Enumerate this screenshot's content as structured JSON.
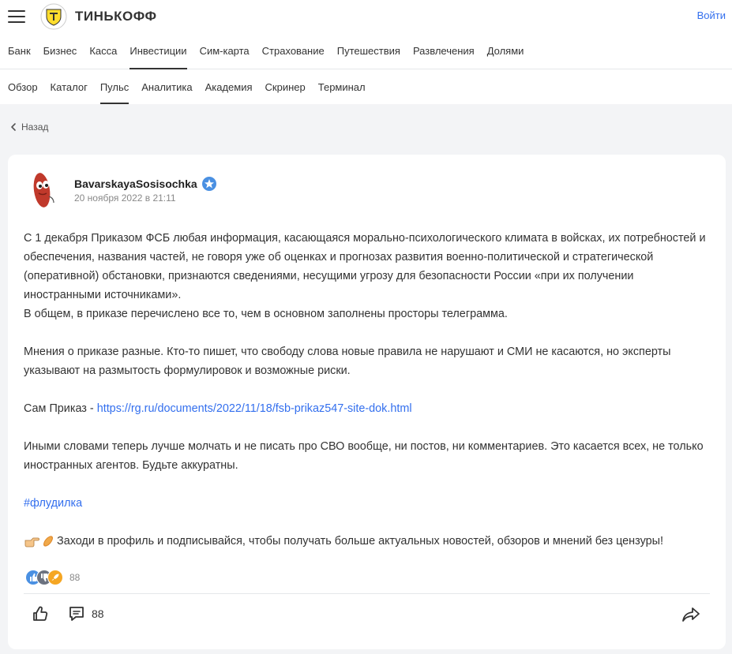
{
  "header": {
    "brand": "ТИНЬКОФФ",
    "login_label": "Войти"
  },
  "main_nav": {
    "items": [
      "Банк",
      "Бизнес",
      "Касса",
      "Инвестиции",
      "Сим-карта",
      "Страхование",
      "Путешествия",
      "Развлечения",
      "Долями"
    ],
    "active": "Инвестиции"
  },
  "sub_nav": {
    "items": [
      "Обзор",
      "Каталог",
      "Пульс",
      "Аналитика",
      "Академия",
      "Скринер",
      "Терминал"
    ],
    "active": "Пульс"
  },
  "back_label": "Назад",
  "post": {
    "author": "BavarskayaSosisochka",
    "date": "20 ноября 2022 в 21:11",
    "paragraph1": "С 1 декабря Приказом ФСБ любая информация, касающаяся морально-психологического климата в войсках, их потребностей и обеспечения, названия частей, не говоря уже об оценках и прогнозах развития военно-политической и стратегической (оперативной) обстановки, признаются сведениями, несущими угрозу для безопасности России «при их получении иностранными источниками».",
    "paragraph2": "В общем, в приказе перечислено все то, чем в основном заполнены просторы телеграмма.",
    "paragraph3": "Мнения о приказе разные. Кто-то пишет, что свободу слова новые правила не нарушают и СМИ не касаются, но эксперты указывают на размытость формулировок и возможные риски.",
    "order_label": "Сам Приказ - ",
    "order_link": "https://rg.ru/documents/2022/11/18/fsb-prikaz547-site-dok.html",
    "paragraph4": "Иными словами теперь лучше молчать и не писать про СВО вообще, ни постов, ни комментариев. Это касается всех, не только иностранных агентов. Будьте аккуратны.",
    "hashtag": "#флудилка",
    "cta": "Заходи в профиль и подписывайся, чтобы получать больше актуальных новостей, обзоров и мнений без цензуры!"
  },
  "reactions": {
    "count": "88",
    "icons": [
      "like-icon",
      "dislike-icon",
      "rocket-icon"
    ],
    "colors": [
      "#4a90e2",
      "#6b7280",
      "#f5a623"
    ]
  },
  "actions": {
    "comments_count": "88"
  }
}
